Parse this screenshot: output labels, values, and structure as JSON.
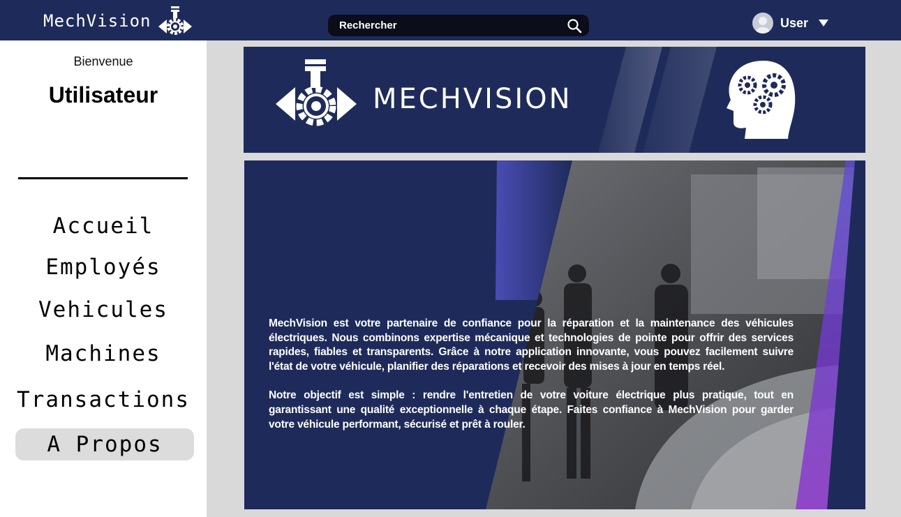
{
  "header": {
    "brand_name": "MechVision",
    "search_placeholder": "Rechercher",
    "user_name": "User"
  },
  "sidebar": {
    "welcome": "Bienvenue",
    "username": "Utilisateur",
    "items": [
      {
        "label": "Accueil"
      },
      {
        "label": "Employés"
      },
      {
        "label": "Vehicules"
      },
      {
        "label": "Machines"
      },
      {
        "label": "Transactions"
      },
      {
        "label": "A Propos",
        "active": true
      }
    ]
  },
  "banner": {
    "title": "MECHVISION"
  },
  "about": {
    "paragraph1": "MechVision est votre partenaire de confiance pour la réparation et la maintenance des véhicules électriques. Nous combinons expertise mécanique et technologies de pointe pour offrir des services rapides, fiables et transparents. Grâce à notre application innovante, vous pouvez facilement suivre l'état de votre véhicule, planifier des réparations et recevoir des mises à jour en temps réel.",
    "paragraph2": "Notre objectif est simple : rendre l'entretien de votre voiture électrique plus pratique, tout en garantissant une qualité exceptionnelle à chaque étape. Faites confiance à MechVision pour garder votre véhicule performant, sécurisé et prêt à rouler."
  },
  "colors": {
    "navy": "#1e2b5a",
    "search_bg": "#0b0d1a",
    "active_item_bg": "#dcdcdc",
    "accent_purple": "#6a3fd6"
  },
  "icons": {
    "brand_logo": "piston-gear-eye-icon",
    "search": "search-icon",
    "user_caret": "caret-down-icon",
    "banner_head": "head-gears-icon"
  }
}
